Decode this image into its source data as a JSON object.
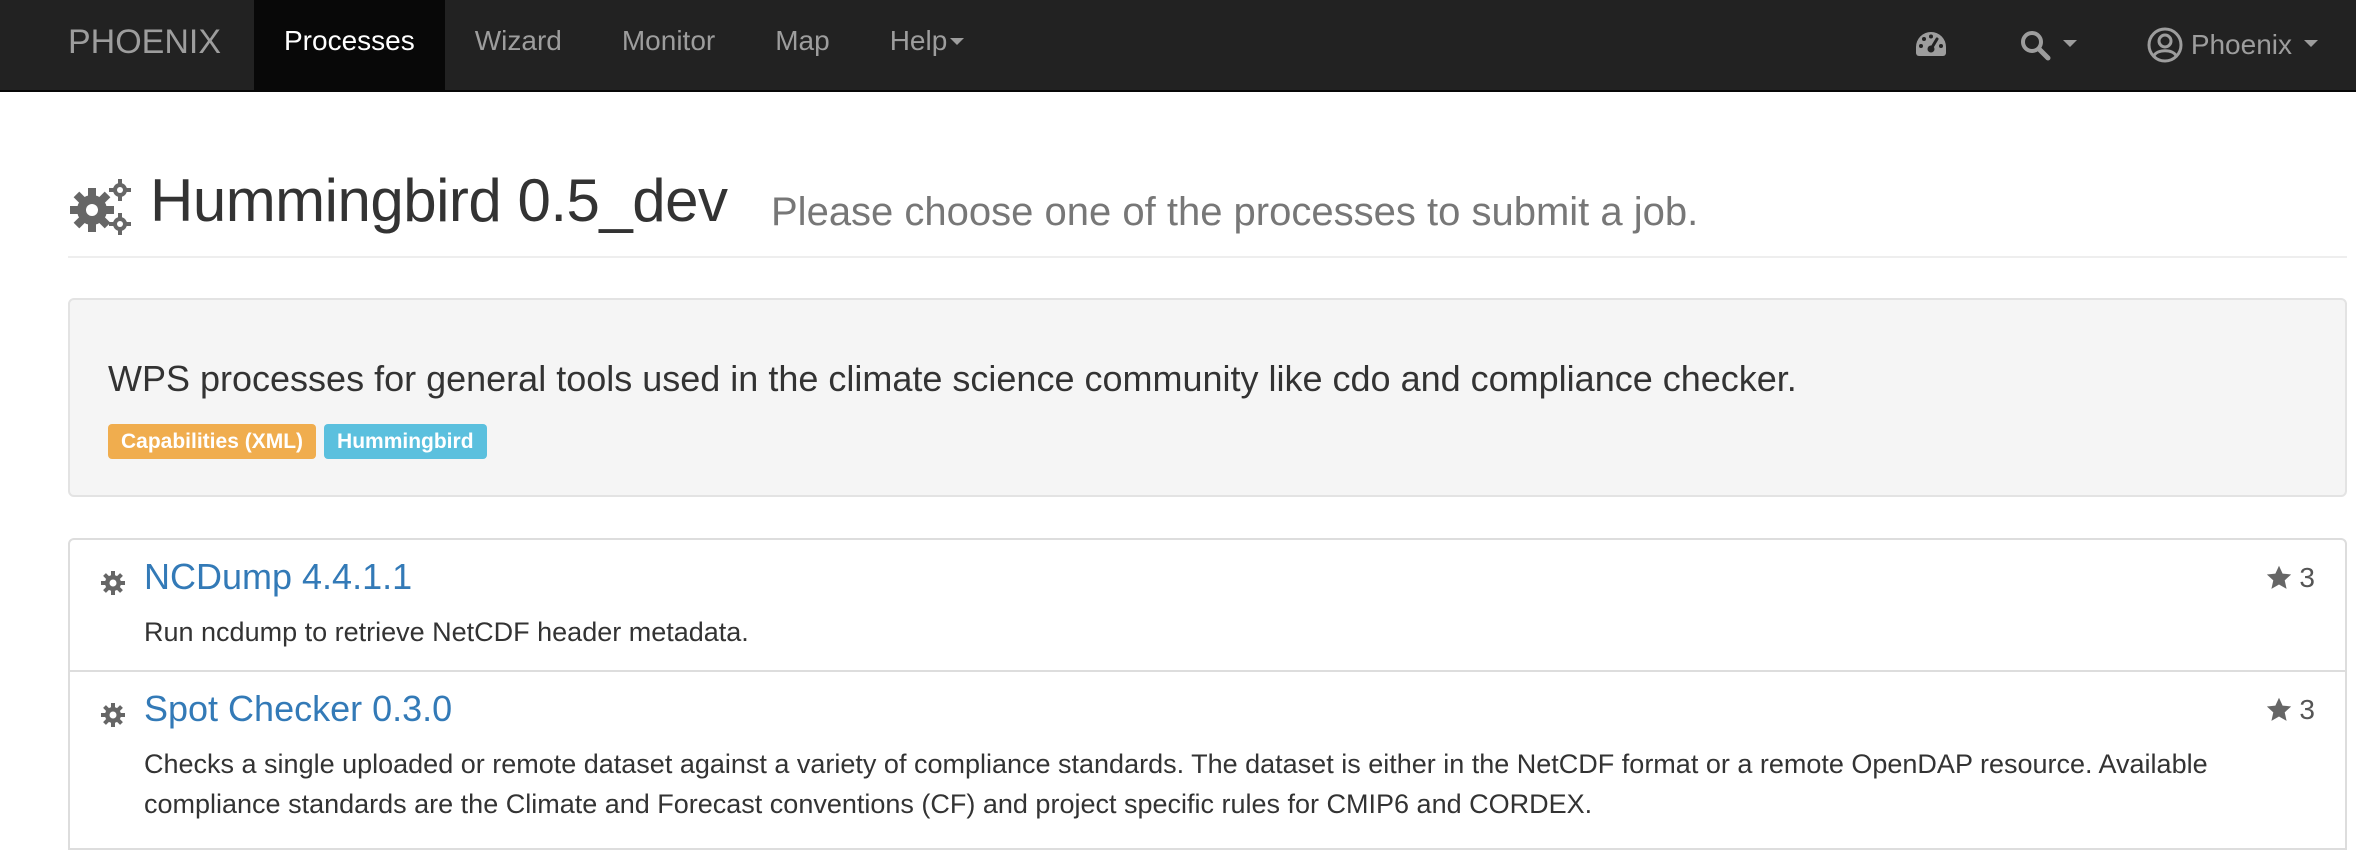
{
  "navbar": {
    "brand": "PHOENIX",
    "items": [
      {
        "label": "Processes",
        "active": true
      },
      {
        "label": "Wizard"
      },
      {
        "label": "Monitor"
      },
      {
        "label": "Map"
      },
      {
        "label": "Help",
        "dropdown": true
      }
    ],
    "right": {
      "dashboard_icon": "dashboard-icon",
      "search_icon": "search-icon",
      "user_icon": "user-circle-icon",
      "user_label": "Phoenix"
    },
    "colors": {
      "background": "#222222",
      "text": "#9d9d9d",
      "active_bg": "#080808",
      "active_text": "#ffffff"
    }
  },
  "header": {
    "icon": "cogs-icon",
    "title": "Hummingbird 0.5_dev",
    "subtitle": "Please choose one of the processes to submit a job."
  },
  "well": {
    "text": "WPS processes for general tools used in the climate science community like cdo and compliance checker.",
    "labels": [
      {
        "text": "Capabilities (XML)",
        "color": "#f0ad4e"
      },
      {
        "text": "Hummingbird",
        "color": "#5bc0de"
      }
    ]
  },
  "processes": [
    {
      "icon": "gear-icon",
      "title": "NCDump 4.4.1.1",
      "description": "Run ncdump to retrieve NetCDF header metadata.",
      "stars": "3"
    },
    {
      "icon": "gear-icon",
      "title": "Spot Checker 0.3.0",
      "description": "Checks a single uploaded or remote dataset against a variety of compliance standards. The dataset is either in the NetCDF format or a remote OpenDAP resource. Available compliance standards are the Climate and Forecast conventions (CF) and project specific rules for CMIP6 and CORDEX.",
      "stars": "3"
    }
  ],
  "colors": {
    "link": "#337ab7",
    "muted": "#777777",
    "well_bg": "#f5f5f5"
  }
}
